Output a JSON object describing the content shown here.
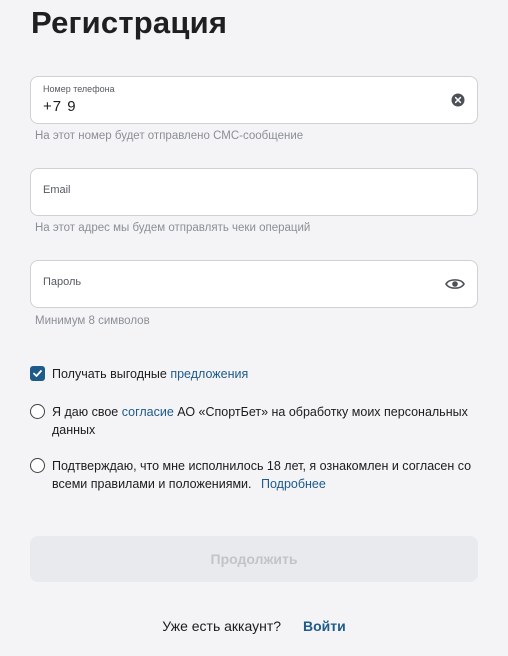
{
  "page": {
    "title": "Регистрация"
  },
  "phone": {
    "label": "Номер телефона",
    "value": "+7 9",
    "hint": "На этот номер будет отправлено СМС-сообщение",
    "clear_icon": "clear-circle-icon"
  },
  "email": {
    "label": "Email",
    "value": "",
    "hint": "На этот адрес мы будем отправлять чеки операций"
  },
  "password": {
    "label": "Пароль",
    "value": "",
    "hint": "Минимум 8 символов",
    "toggle_icon": "eye-icon"
  },
  "consents": {
    "offers": {
      "checked": true,
      "text": "Получать выгодные",
      "link": "предложения"
    },
    "personal_data": {
      "checked": false,
      "text_before": "Я даю свое",
      "link": "согласие",
      "text_after": "АО «СпортБет» на обработку моих персональных данных"
    },
    "age": {
      "checked": false,
      "text": "Подтверждаю, что мне исполнилось 18 лет, я ознакомлен и согласен со всеми правилами и положениями.",
      "link": "Подробнее"
    }
  },
  "actions": {
    "continue_label": "Продолжить",
    "continue_enabled": false
  },
  "footer": {
    "question": "Уже есть аккаунт?",
    "login_label": "Войти"
  },
  "colors": {
    "accent": "#1e5a8a",
    "background": "#f4f4f6",
    "disabled_button": "#e9eaed"
  }
}
